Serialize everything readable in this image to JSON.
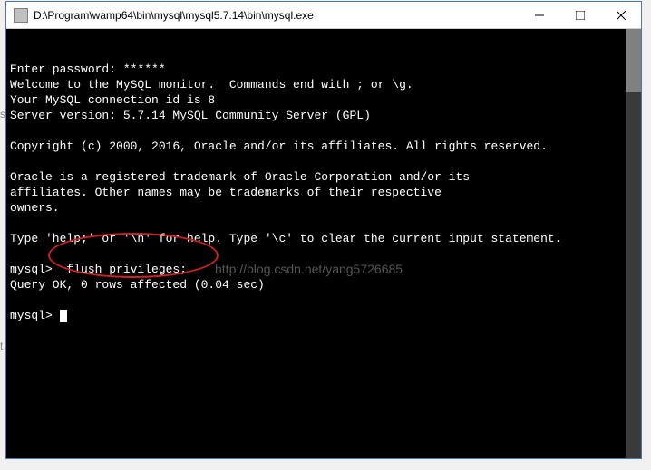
{
  "window": {
    "title": "D:\\Program\\wamp64\\bin\\mysql\\mysql5.7.14\\bin\\mysql.exe"
  },
  "terminal": {
    "line1": "Enter password: ******",
    "line2": "Welcome to the MySQL monitor.  Commands end with ; or \\g.",
    "line3": "Your MySQL connection id is 8",
    "line4": "Server version: 5.7.14 MySQL Community Server (GPL)",
    "line5": "",
    "line6": "Copyright (c) 2000, 2016, Oracle and/or its affiliates. All rights reserved.",
    "line7": "",
    "line8": "Oracle is a registered trademark of Oracle Corporation and/or its",
    "line9": "affiliates. Other names may be trademarks of their respective",
    "line10": "owners.",
    "line11": "",
    "line12": "Type 'help;' or '\\h' for help. Type '\\c' to clear the current input statement.",
    "line13": "",
    "prompt1": "mysql> ",
    "command1": " flush privileges;",
    "result1": "Query OK, 0 rows affected (0.04 sec)",
    "line14": "",
    "prompt2": "mysql> "
  },
  "watermark": "http://blog.csdn.net/yang5726685",
  "artifacts": {
    "left1": "so",
    "left2": "t"
  }
}
